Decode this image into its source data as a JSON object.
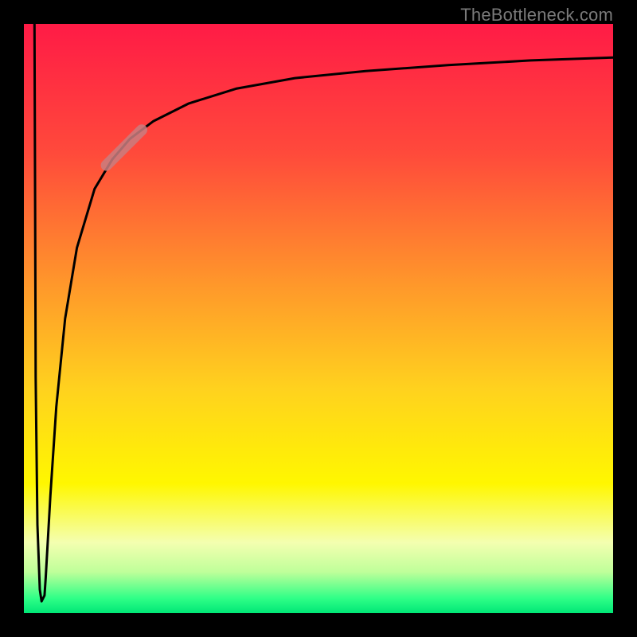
{
  "watermark": "TheBottleneck.com",
  "chart_data": {
    "type": "line",
    "title": "",
    "xlabel": "",
    "ylabel": "",
    "xlim": [
      0,
      100
    ],
    "ylim": [
      0,
      100
    ],
    "grid": false,
    "annotations": [],
    "note": "x/y are in percent of the inner plot box (0,0 = bottom-left). The curve shows an extremely narrow dip to near-zero at x≈2 then rises steeply and asymptotes close to the top; values are estimated from the figure.",
    "series": [
      {
        "name": "curve",
        "points": [
          {
            "x": 1.8,
            "y": 100.0
          },
          {
            "x": 1.9,
            "y": 70.0
          },
          {
            "x": 2.0,
            "y": 40.0
          },
          {
            "x": 2.3,
            "y": 15.0
          },
          {
            "x": 2.7,
            "y": 4.0
          },
          {
            "x": 3.0,
            "y": 2.0
          },
          {
            "x": 3.5,
            "y": 3.0
          },
          {
            "x": 3.7,
            "y": 6.0
          },
          {
            "x": 4.5,
            "y": 20.0
          },
          {
            "x": 5.5,
            "y": 35.0
          },
          {
            "x": 7.0,
            "y": 50.0
          },
          {
            "x": 9.0,
            "y": 62.0
          },
          {
            "x": 12.0,
            "y": 72.0
          },
          {
            "x": 15.0,
            "y": 77.0
          },
          {
            "x": 18.0,
            "y": 80.5
          },
          {
            "x": 22.0,
            "y": 83.5
          },
          {
            "x": 28.0,
            "y": 86.5
          },
          {
            "x": 36.0,
            "y": 89.0
          },
          {
            "x": 46.0,
            "y": 90.8
          },
          {
            "x": 58.0,
            "y": 92.0
          },
          {
            "x": 72.0,
            "y": 93.0
          },
          {
            "x": 86.0,
            "y": 93.8
          },
          {
            "x": 100.0,
            "y": 94.3
          }
        ]
      }
    ],
    "highlight_segment": {
      "description": "a short thickened pinkish segment on the ascending part of the curve",
      "start": {
        "x": 14.0,
        "y": 76.0
      },
      "end": {
        "x": 20.0,
        "y": 82.0
      }
    },
    "background_gradient": {
      "direction": "vertical",
      "stops": [
        {
          "pos": 0.0,
          "color": "#ff1b46"
        },
        {
          "pos": 0.22,
          "color": "#ff4a3b"
        },
        {
          "pos": 0.45,
          "color": "#ff9a2a"
        },
        {
          "pos": 0.62,
          "color": "#ffd21e"
        },
        {
          "pos": 0.78,
          "color": "#fff700"
        },
        {
          "pos": 0.88,
          "color": "#f4ffb0"
        },
        {
          "pos": 0.93,
          "color": "#bfff9a"
        },
        {
          "pos": 0.975,
          "color": "#2fff87"
        },
        {
          "pos": 1.0,
          "color": "#00e676"
        }
      ]
    }
  }
}
